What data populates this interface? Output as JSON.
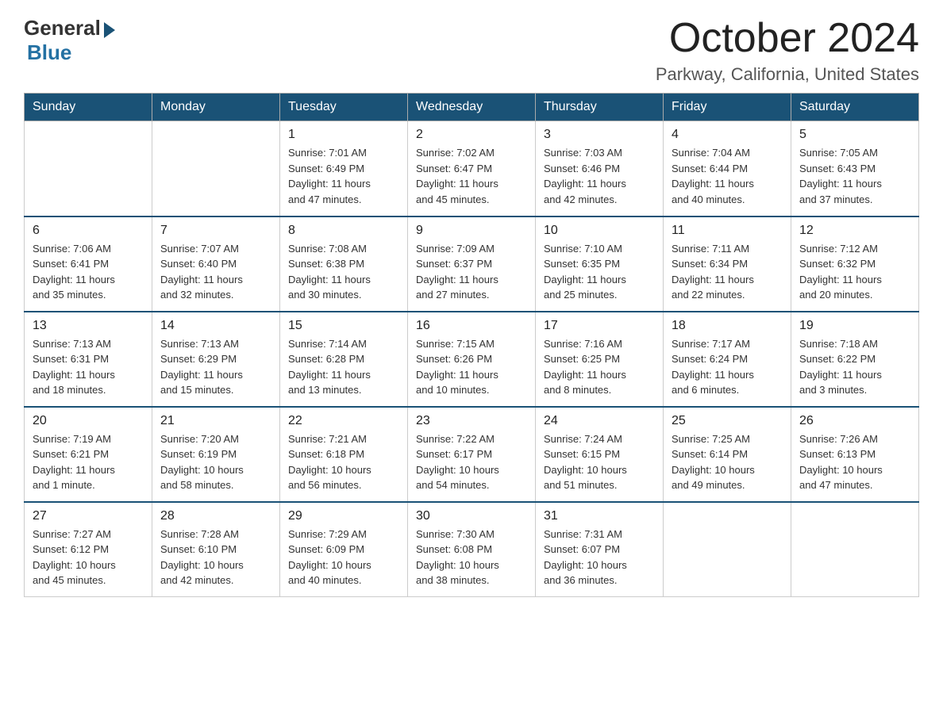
{
  "logo": {
    "general": "General",
    "blue": "Blue"
  },
  "title": "October 2024",
  "location": "Parkway, California, United States",
  "weekdays": [
    "Sunday",
    "Monday",
    "Tuesday",
    "Wednesday",
    "Thursday",
    "Friday",
    "Saturday"
  ],
  "weeks": [
    [
      {
        "day": "",
        "info": ""
      },
      {
        "day": "",
        "info": ""
      },
      {
        "day": "1",
        "info": "Sunrise: 7:01 AM\nSunset: 6:49 PM\nDaylight: 11 hours\nand 47 minutes."
      },
      {
        "day": "2",
        "info": "Sunrise: 7:02 AM\nSunset: 6:47 PM\nDaylight: 11 hours\nand 45 minutes."
      },
      {
        "day": "3",
        "info": "Sunrise: 7:03 AM\nSunset: 6:46 PM\nDaylight: 11 hours\nand 42 minutes."
      },
      {
        "day": "4",
        "info": "Sunrise: 7:04 AM\nSunset: 6:44 PM\nDaylight: 11 hours\nand 40 minutes."
      },
      {
        "day": "5",
        "info": "Sunrise: 7:05 AM\nSunset: 6:43 PM\nDaylight: 11 hours\nand 37 minutes."
      }
    ],
    [
      {
        "day": "6",
        "info": "Sunrise: 7:06 AM\nSunset: 6:41 PM\nDaylight: 11 hours\nand 35 minutes."
      },
      {
        "day": "7",
        "info": "Sunrise: 7:07 AM\nSunset: 6:40 PM\nDaylight: 11 hours\nand 32 minutes."
      },
      {
        "day": "8",
        "info": "Sunrise: 7:08 AM\nSunset: 6:38 PM\nDaylight: 11 hours\nand 30 minutes."
      },
      {
        "day": "9",
        "info": "Sunrise: 7:09 AM\nSunset: 6:37 PM\nDaylight: 11 hours\nand 27 minutes."
      },
      {
        "day": "10",
        "info": "Sunrise: 7:10 AM\nSunset: 6:35 PM\nDaylight: 11 hours\nand 25 minutes."
      },
      {
        "day": "11",
        "info": "Sunrise: 7:11 AM\nSunset: 6:34 PM\nDaylight: 11 hours\nand 22 minutes."
      },
      {
        "day": "12",
        "info": "Sunrise: 7:12 AM\nSunset: 6:32 PM\nDaylight: 11 hours\nand 20 minutes."
      }
    ],
    [
      {
        "day": "13",
        "info": "Sunrise: 7:13 AM\nSunset: 6:31 PM\nDaylight: 11 hours\nand 18 minutes."
      },
      {
        "day": "14",
        "info": "Sunrise: 7:13 AM\nSunset: 6:29 PM\nDaylight: 11 hours\nand 15 minutes."
      },
      {
        "day": "15",
        "info": "Sunrise: 7:14 AM\nSunset: 6:28 PM\nDaylight: 11 hours\nand 13 minutes."
      },
      {
        "day": "16",
        "info": "Sunrise: 7:15 AM\nSunset: 6:26 PM\nDaylight: 11 hours\nand 10 minutes."
      },
      {
        "day": "17",
        "info": "Sunrise: 7:16 AM\nSunset: 6:25 PM\nDaylight: 11 hours\nand 8 minutes."
      },
      {
        "day": "18",
        "info": "Sunrise: 7:17 AM\nSunset: 6:24 PM\nDaylight: 11 hours\nand 6 minutes."
      },
      {
        "day": "19",
        "info": "Sunrise: 7:18 AM\nSunset: 6:22 PM\nDaylight: 11 hours\nand 3 minutes."
      }
    ],
    [
      {
        "day": "20",
        "info": "Sunrise: 7:19 AM\nSunset: 6:21 PM\nDaylight: 11 hours\nand 1 minute."
      },
      {
        "day": "21",
        "info": "Sunrise: 7:20 AM\nSunset: 6:19 PM\nDaylight: 10 hours\nand 58 minutes."
      },
      {
        "day": "22",
        "info": "Sunrise: 7:21 AM\nSunset: 6:18 PM\nDaylight: 10 hours\nand 56 minutes."
      },
      {
        "day": "23",
        "info": "Sunrise: 7:22 AM\nSunset: 6:17 PM\nDaylight: 10 hours\nand 54 minutes."
      },
      {
        "day": "24",
        "info": "Sunrise: 7:24 AM\nSunset: 6:15 PM\nDaylight: 10 hours\nand 51 minutes."
      },
      {
        "day": "25",
        "info": "Sunrise: 7:25 AM\nSunset: 6:14 PM\nDaylight: 10 hours\nand 49 minutes."
      },
      {
        "day": "26",
        "info": "Sunrise: 7:26 AM\nSunset: 6:13 PM\nDaylight: 10 hours\nand 47 minutes."
      }
    ],
    [
      {
        "day": "27",
        "info": "Sunrise: 7:27 AM\nSunset: 6:12 PM\nDaylight: 10 hours\nand 45 minutes."
      },
      {
        "day": "28",
        "info": "Sunrise: 7:28 AM\nSunset: 6:10 PM\nDaylight: 10 hours\nand 42 minutes."
      },
      {
        "day": "29",
        "info": "Sunrise: 7:29 AM\nSunset: 6:09 PM\nDaylight: 10 hours\nand 40 minutes."
      },
      {
        "day": "30",
        "info": "Sunrise: 7:30 AM\nSunset: 6:08 PM\nDaylight: 10 hours\nand 38 minutes."
      },
      {
        "day": "31",
        "info": "Sunrise: 7:31 AM\nSunset: 6:07 PM\nDaylight: 10 hours\nand 36 minutes."
      },
      {
        "day": "",
        "info": ""
      },
      {
        "day": "",
        "info": ""
      }
    ]
  ]
}
